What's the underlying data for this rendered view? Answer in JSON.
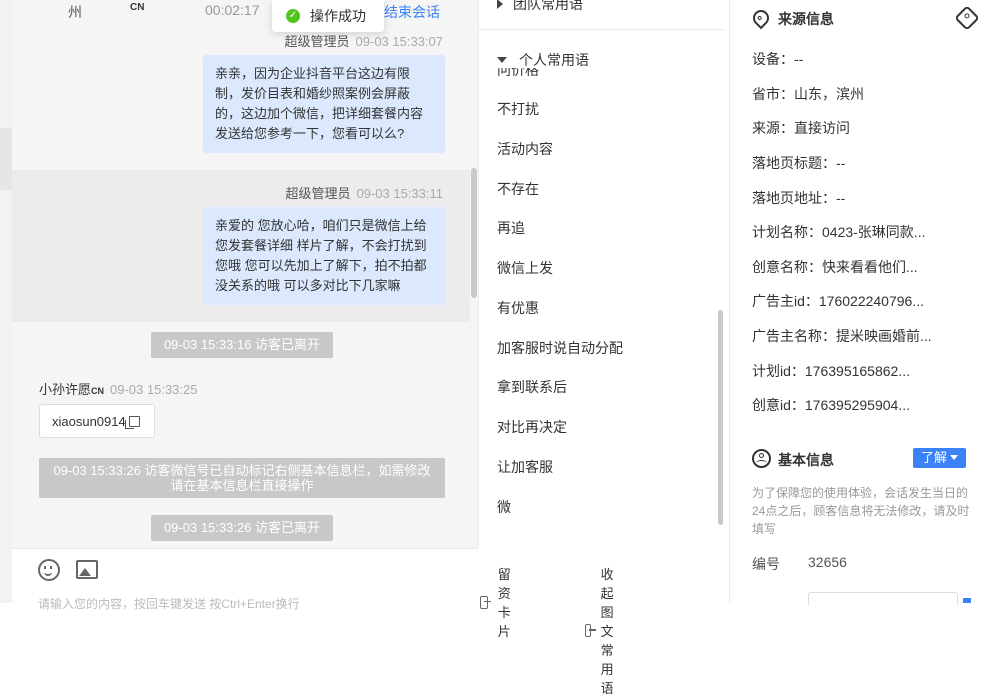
{
  "toast": {
    "text": "操作成功"
  },
  "chat": {
    "topbar": {
      "location": "州",
      "cn_tag": "CN",
      "duration": "00:02:17",
      "end_link": "结束会话"
    },
    "messages": [
      {
        "sender": "超级管理员",
        "time": "09-03 15:33:07",
        "text": "亲亲，因为企业抖音平台这边有限制，发价目表和婚纱照案例会屏蔽的，这边加个微信，把详细套餐内容发送给您参考一下，您看可以么?"
      },
      {
        "sender": "超级管理员",
        "time": "09-03 15:33:11",
        "text": "亲爱的 您放心哈，咱们只是微信上给您发套餐详细 样片了解，不会打扰到您哦 您可以先加上了解下，拍不拍都没关系的哦 可以多对比下几家嘛"
      }
    ],
    "system": [
      "09-03 15:33:16 访客已离开",
      "09-03 15:33:26 访客微信号已自动标记右侧基本信息栏，如需修改请在基本信息栏直接操作",
      "09-03 15:33:26 访客已离开"
    ],
    "visitor": {
      "name": "小孙许愿",
      "tag": "CN",
      "time": "09-03 15:33:25",
      "wechat_id": "xiaosun0914"
    },
    "input": {
      "placeholder": "请输入您的内容，按回车键发送 按Ctrl+Enter换行",
      "lead_card": "留资卡片",
      "collapse_phrases": "收起图文常用语"
    }
  },
  "phrases": {
    "team_group": "团队常用语",
    "personal_group": "个人常用语",
    "partial_item": "问价格",
    "items": [
      "不打扰",
      "活动内容",
      "不存在",
      "再追",
      "微信上发",
      "有优惠",
      "加客服时说自动分配",
      "拿到联系后",
      "对比再决定",
      "让加客服",
      "微"
    ]
  },
  "info": {
    "source": {
      "title": "来源信息",
      "fields": [
        "设备：--",
        "省市：山东，滨州",
        "来源：直接访问",
        "落地页标题：--",
        "落地页地址：--",
        "计划名称：0423-张琳同款...",
        "创意名称：快来看看他们...",
        "广告主id：176022240796...",
        "广告主名称：提米映画婚前...",
        "计划id：176395165862...",
        "创意id：176395295904..."
      ]
    },
    "basic": {
      "title": "基本信息",
      "know_more": "了解",
      "note": "为了保障您的使用体验，会话发生当日的24点之后，顾客信息将无法修改，请及时填写",
      "number_label": "编号",
      "number_value": "32656"
    }
  },
  "colors": {
    "accent": "#3b82f6",
    "bubble": "#dbe8fd",
    "success": "#52c41a"
  }
}
